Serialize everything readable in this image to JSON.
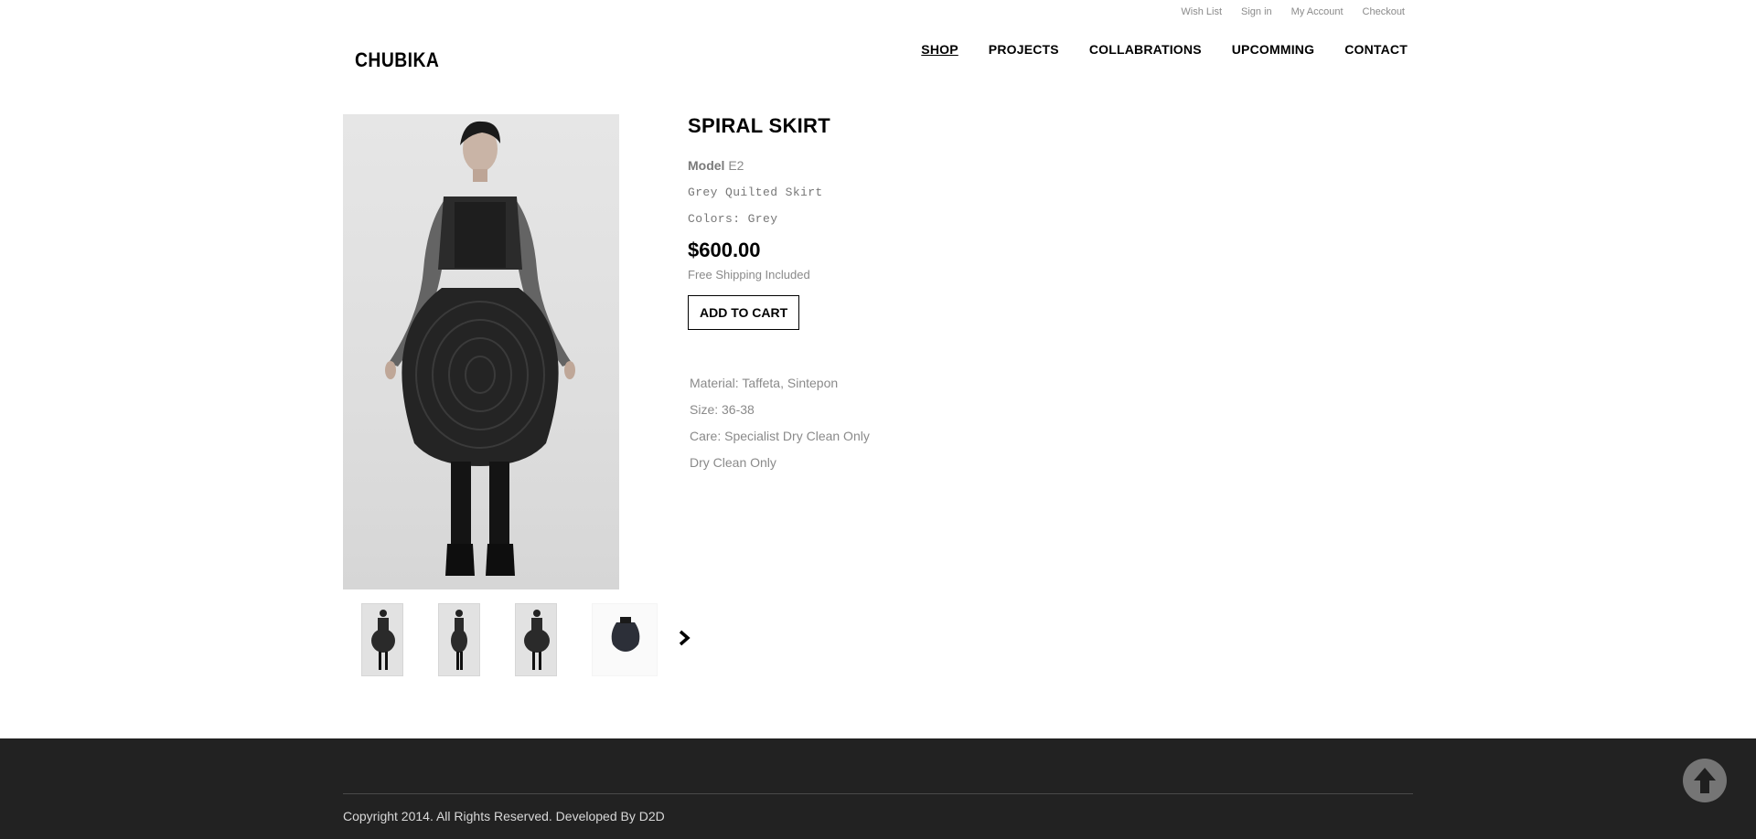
{
  "top_links": [
    "Wish List",
    "Sign in",
    "My Account",
    "Checkout"
  ],
  "logo": "CHUBIKA",
  "nav": [
    {
      "label": "SHOP",
      "active": true
    },
    {
      "label": "PROJECTS",
      "active": false
    },
    {
      "label": "COLLABRATIONS",
      "active": false
    },
    {
      "label": "UPCOMMING",
      "active": false
    },
    {
      "label": "CONTACT",
      "active": false
    }
  ],
  "product": {
    "title": "SPIRAL SKIRT",
    "model_label": "Model",
    "model_value": "E2",
    "description": "Grey Quilted Skirt",
    "colors": "Colors: Grey",
    "price": "$600.00",
    "shipping": "Free Shipping Included",
    "add_to_cart": "ADD TO CART"
  },
  "specs": [
    "Material: Taffeta, Sintepon",
    "Size: 36-38",
    "Care:  Specialist Dry Clean Only",
    "Dry Clean Only"
  ],
  "thumbnails": [
    "front-view-thumbnail",
    "side-view-thumbnail",
    "back-view-thumbnail",
    "skirt-detail-thumbnail"
  ],
  "icons": {
    "next": "chevron-right-icon",
    "scroll_top": "arrow-up-icon"
  },
  "colors": {
    "footer_bg": "#222222",
    "text_grey": "#8a8a8a",
    "accent": "#000000"
  },
  "footer": {
    "copyright": "Copyright 2014. All Rights Reserved. Developed By D2D"
  }
}
